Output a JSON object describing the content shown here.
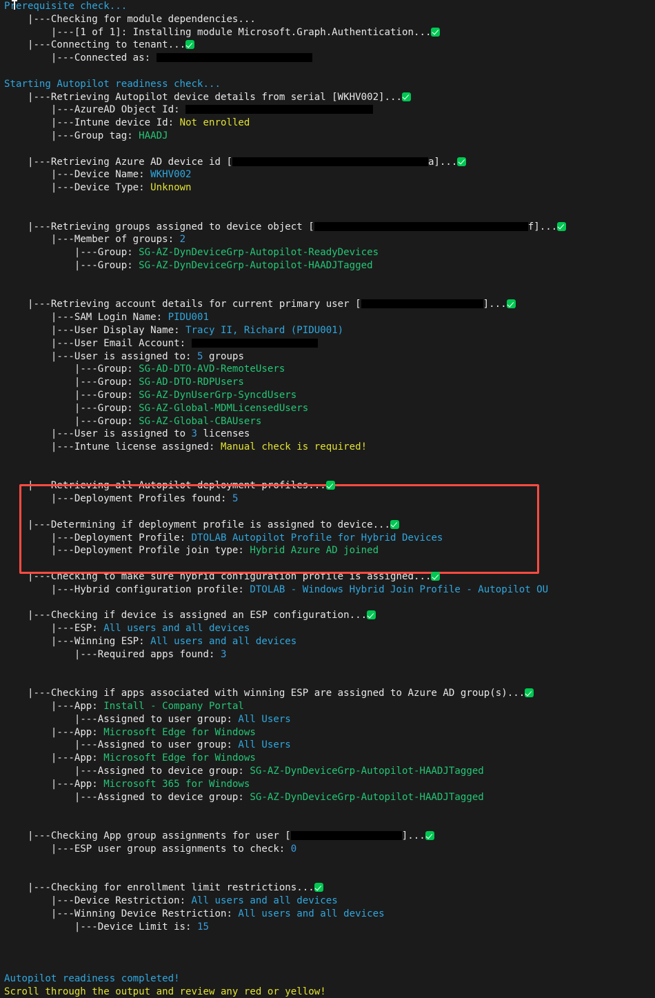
{
  "terminal": {
    "background_color": "#1b1b1b",
    "highlight_box_color": "#ff4b42",
    "colors": {
      "cyan": "#2fa8e0",
      "green": "#24c776",
      "yellow": "#e2e234",
      "white": "#e8e8e8",
      "check_badge": "#00c853"
    },
    "lines": {
      "l01_prereq": "Prerequisite check...",
      "l02_checking_modules": "|---Checking for module dependencies...",
      "l03_installing_module": "|---[1 of 1]: Installing module Microsoft.Graph.Authentication...",
      "l04_connecting_tenant": "|---Connecting to tenant...",
      "l05_connected_as_label": "|---Connected as: ",
      "l06_starting": "Starting Autopilot readiness check...",
      "l07_retrieving_ap_device": "|---Retrieving Autopilot device details from serial [WKHV002]...",
      "l08_azuread_object_label": "|---AzureAD Object Id: ",
      "l09_intune_device_label": "|---Intune device Id: ",
      "l09_intune_device_value": "Not enrolled",
      "l10_group_tag_label": "|---Group tag: ",
      "l10_group_tag_value": "HAADJ",
      "l11_retrieving_azuread_pre": "|---Retrieving Azure AD device id [",
      "l11_retrieving_azuread_post": "a]...",
      "l12_device_name_label": "|---Device Name: ",
      "l12_device_name_value": "WKHV002",
      "l13_device_type_label": "|---Device Type: ",
      "l13_device_type_value": "Unknown",
      "l14_retrieving_groups_pre": "|---Retrieving groups assigned to device object [",
      "l14_retrieving_groups_post": "f]...",
      "l15_member_of_groups_label": "|---Member of groups: ",
      "l15_member_of_groups_value": "2",
      "l16_group_label": "|---Group: ",
      "l16_group_value": "SG-AZ-DynDeviceGrp-Autopilot-ReadyDevices",
      "l17_group_label": "|---Group: ",
      "l17_group_value": "SG-AZ-DynDeviceGrp-Autopilot-HAADJTagged",
      "l18_retrieving_account_pre": "|---Retrieving account details for current primary user [",
      "l18_retrieving_account_post": "]...",
      "l19_sam_label": "|---SAM Login Name: ",
      "l19_sam_value": "PIDU001",
      "l20_display_name_label": "|---User Display Name: ",
      "l20_display_name_value": "Tracy II, Richard (PIDU001)",
      "l21_email_label": "|---User Email Account: ",
      "l22_user_assigned_pre": "|---User is assigned to: ",
      "l22_user_assigned_count": "5",
      "l22_user_assigned_post": " groups",
      "l23_group_value": "SG-AD-DTO-AVD-RemoteUsers",
      "l24_group_value": "SG-AD-DTO-RDPUsers",
      "l25_group_value": "SG-AZ-DynUserGrp-SyncdUsers",
      "l26_group_value": "SG-AZ-Global-MDMLicensedUsers",
      "l27_group_value": "SG-AZ-Global-CBAUsers",
      "l28_licenses_pre": "|---User is assigned to ",
      "l28_licenses_count": "3",
      "l28_licenses_post": " licenses",
      "l29_intune_license_label": "|---Intune license assigned: ",
      "l29_intune_license_value": "Manual check is required!",
      "l30_retrieving_profiles": "|---Retrieving all Autopilot deployment profiles...",
      "l31_profiles_found_label": "|---Deployment Profiles found: ",
      "l31_profiles_found_value": "5",
      "l32_determining_profile": "|---Determining if deployment profile is assigned to device...",
      "l33_deployment_profile_label": "|---Deployment Profile: ",
      "l33_deployment_profile_value": "DTOLAB Autopilot Profile for Hybrid Devices",
      "l34_join_type_label": "|---Deployment Profile join type: ",
      "l34_join_type_value": "Hybrid Azure AD joined",
      "l35_checking_hybrid": "|---Checking to make sure hybrid configuration profile is assigned...",
      "l36_hybrid_profile_label": "|---Hybrid configuration profile: ",
      "l36_hybrid_profile_value": "DTOLAB - Windows Hybrid Join Profile - Autopilot OU",
      "l37_checking_esp": "|---Checking if device is assigned an ESP configuration...",
      "l38_esp_label": "|---ESP: ",
      "l38_esp_value": "All users and all devices",
      "l39_winning_esp_label": "|---Winning ESP: ",
      "l39_winning_esp_value": "All users and all devices",
      "l40_required_apps_label": "|---Required apps found: ",
      "l40_required_apps_value": "3",
      "l41_checking_apps": "|---Checking if apps associated with winning ESP are assigned to Azure AD group(s)...",
      "l42_app_label": "|---App: ",
      "l42_app_value": "Install - Company Portal",
      "l43_assigned_user_label": "|---Assigned to user group: ",
      "l43_assigned_user_value": "All Users",
      "l44_app_value": "Microsoft Edge for Windows",
      "l45_assigned_user_value": "All Users",
      "l46_app_value": "Microsoft Edge for Windows",
      "l47_assigned_device_label": "|---Assigned to device group: ",
      "l47_assigned_device_value": "SG-AZ-DynDeviceGrp-Autopilot-HAADJTagged",
      "l48_app_value": "Microsoft 365 for Windows",
      "l49_assigned_device_value": "SG-AZ-DynDeviceGrp-Autopilot-HAADJTagged",
      "l50_checking_app_groups_pre": "|---Checking App group assignments for user [",
      "l50_checking_app_groups_post": "]...",
      "l51_esp_user_group_label": "|---ESP user group assignments to check: ",
      "l51_esp_user_group_value": "0",
      "l52_checking_enrollment": "|---Checking for enrollment limit restrictions...",
      "l53_device_restriction_label": "|---Device Restriction: ",
      "l53_device_restriction_value": "All users and all devices",
      "l54_winning_restriction_label": "|---Winning Device Restriction: ",
      "l54_winning_restriction_value": "All users and all devices",
      "l55_device_limit_label": "|---Device Limit is: ",
      "l55_device_limit_value": "15",
      "l56_completed": "Autopilot readiness completed!",
      "l57_scroll_note": "Scroll through the output and review any red or yellow!"
    }
  }
}
